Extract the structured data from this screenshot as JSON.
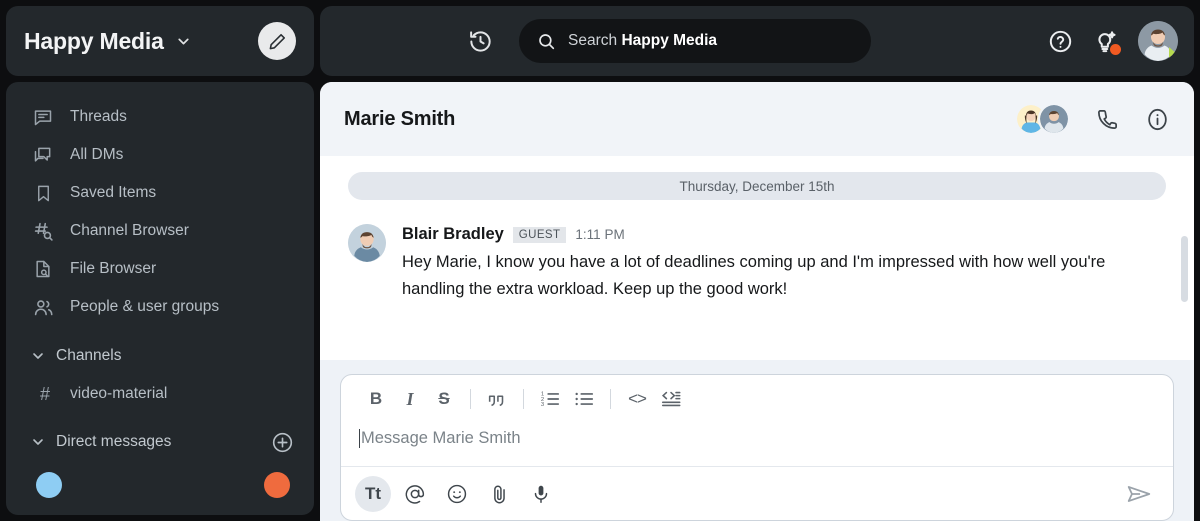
{
  "workspace": {
    "name": "Happy Media",
    "caret_icon": "chevron-down-icon",
    "compose_icon": "pencil-icon"
  },
  "sidebar": {
    "items": [
      {
        "label": "Threads",
        "icon": "threads-icon"
      },
      {
        "label": "All DMs",
        "icon": "all-dms-icon"
      },
      {
        "label": "Saved Items",
        "icon": "bookmark-icon"
      },
      {
        "label": "Channel Browser",
        "icon": "channel-browser-icon"
      },
      {
        "label": "File Browser",
        "icon": "file-browser-icon"
      },
      {
        "label": "People & user groups",
        "icon": "people-icon"
      }
    ],
    "channels_section": {
      "label": "Channels",
      "caret_icon": "chevron-down-icon",
      "channels": [
        {
          "label": "video-material",
          "prefix": "#"
        }
      ]
    },
    "dm_section": {
      "label": "Direct messages",
      "caret_icon": "chevron-down-icon",
      "add_icon": "plus-circle-icon"
    }
  },
  "topbar": {
    "history_icon": "history-icon",
    "search": {
      "icon": "search-icon",
      "prefix": "Search",
      "scope": "Happy Media"
    },
    "help_icon": "help-circle-icon",
    "ai_icon": "lightbulb-sparkle-icon",
    "ai_badge_color": "#f15a22",
    "avatar": "user-avatar",
    "avatar_status_color": "#b0d84a"
  },
  "conversation": {
    "title": "Marie Smith",
    "members_icon": "member-avatars",
    "call_icon": "phone-icon",
    "info_icon": "info-circle-icon",
    "date_divider": "Thursday, December 15th",
    "messages": [
      {
        "author": "Blair Bradley",
        "badge": "GUEST",
        "time": "1:11 PM",
        "text": "Hey Marie, I know you have a lot of deadlines coming up and I'm impressed with how well you're handling the extra workload. Keep up the good work!"
      }
    ]
  },
  "composer": {
    "placeholder": "Message Marie Smith",
    "format_buttons": [
      {
        "name": "bold",
        "glyph": "B"
      },
      {
        "name": "italic",
        "glyph": "I"
      },
      {
        "name": "strikethrough",
        "glyph": "S"
      },
      {
        "name": "blockquote",
        "glyph": "””"
      },
      {
        "name": "ordered-list",
        "glyph": ""
      },
      {
        "name": "bulleted-list",
        "glyph": ""
      },
      {
        "name": "code",
        "glyph": "<>"
      },
      {
        "name": "code-block",
        "glyph": ""
      }
    ],
    "tools": [
      {
        "name": "formatting",
        "glyph": "Tt",
        "active": true
      },
      {
        "name": "mention",
        "glyph": "@",
        "active": false
      },
      {
        "name": "emoji",
        "glyph": "",
        "active": false
      },
      {
        "name": "attachment",
        "glyph": "",
        "active": false
      },
      {
        "name": "audio",
        "glyph": "",
        "active": false
      }
    ],
    "send_icon": "send-icon"
  }
}
